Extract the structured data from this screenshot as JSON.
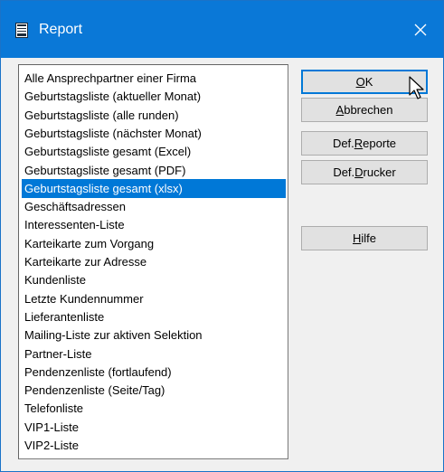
{
  "window": {
    "title": "Report",
    "close_symbol": "✕",
    "icon": "report-document-icon",
    "accent_color": "#0078d7",
    "titlebar_color": "#0a78d7"
  },
  "list": {
    "selected_index": 6,
    "items": [
      "Alle Ansprechpartner einer Firma",
      "Geburtstagsliste (aktueller Monat)",
      "Geburtstagsliste (alle runden)",
      "Geburtstagsliste (nächster Monat)",
      "Geburtstagsliste gesamt (Excel)",
      "Geburtstagsliste gesamt (PDF)",
      "Geburtstagsliste gesamt (xlsx)",
      "Geschäftsadressen",
      "Interessenten-Liste",
      "Karteikarte zum Vorgang",
      "Karteikarte zur Adresse",
      "Kundenliste",
      "Letzte Kundennummer",
      "Lieferantenliste",
      "Mailing-Liste zur aktiven Selektion",
      "Partner-Liste",
      "Pendenzenliste (fortlaufend)",
      "Pendenzenliste (Seite/Tag)",
      "Telefonliste",
      "VIP1-Liste",
      "VIP2-Liste"
    ]
  },
  "buttons": {
    "ok": {
      "before": "",
      "key": "O",
      "after": "K"
    },
    "cancel": {
      "before": "",
      "key": "A",
      "after": "bbrechen"
    },
    "def_reports": {
      "before": "Def.",
      "key": "R",
      "after": "eporte"
    },
    "def_printer": {
      "before": "Def.",
      "key": "D",
      "after": "rucker"
    },
    "help": {
      "before": "",
      "key": "H",
      "after": "ilfe"
    }
  }
}
